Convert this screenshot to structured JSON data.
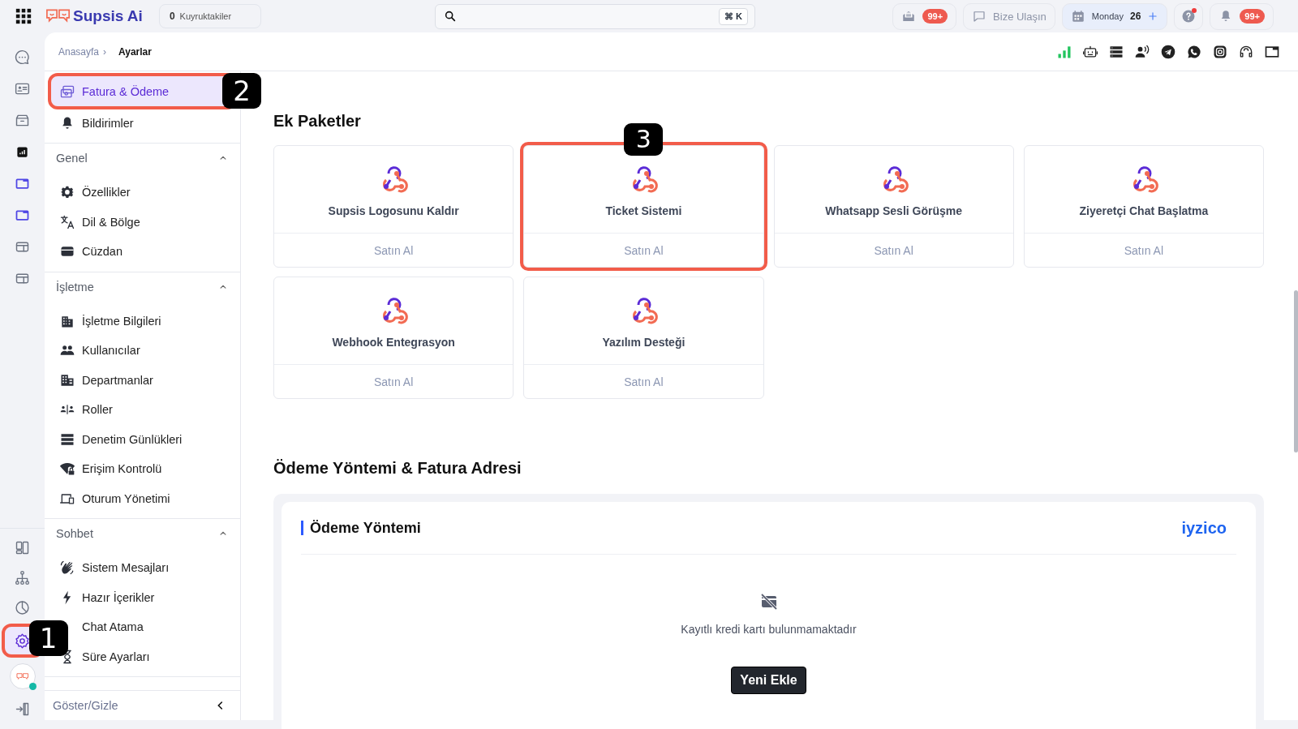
{
  "top_bar": {
    "logo": "Supsis Ai",
    "queue_count": "0",
    "queue_label": "Kuyruktakiler",
    "search_shortcut": "⌘ K",
    "inbox_badge": "99+",
    "contact_label": "Bize Ulaşın",
    "date_day": "Monday",
    "date_num": "26",
    "help_alert": true,
    "notifications_badge": "99+"
  },
  "rail": {
    "items": [
      {
        "selected": false
      },
      {
        "selected": false
      },
      {
        "selected": false
      },
      {
        "selected": false
      },
      {
        "selected": false
      },
      {
        "selected": false
      },
      {
        "selected": false
      },
      {
        "selected": false
      }
    ],
    "bottom_items": [
      {
        "selected": false
      },
      {
        "selected": false
      },
      {
        "selected": false
      },
      {
        "selected": true,
        "callout": "1"
      }
    ],
    "avatar_online": true
  },
  "breadcrumb": {
    "items": [
      "Anasayfa",
      "Ayarlar"
    ],
    "separator": "›"
  },
  "sidebar": {
    "items": [
      {
        "label": "Fatura & Ödeme",
        "selected": true,
        "callout": "2"
      },
      {
        "label": "Bildirimler",
        "selected": false
      }
    ],
    "sections": [
      {
        "title": "Genel",
        "expanded": true,
        "items": [
          {
            "label": "Özellikler",
            "selected": false
          },
          {
            "label": "Dil & Bölge",
            "selected": false
          },
          {
            "label": "Cüzdan",
            "selected": false
          }
        ]
      },
      {
        "title": "İşletme",
        "expanded": true,
        "items": [
          {
            "label": "İşletme Bilgileri",
            "selected": false
          },
          {
            "label": "Kullanıcılar",
            "selected": false
          },
          {
            "label": "Departmanlar",
            "selected": false
          },
          {
            "label": "Roller",
            "selected": false
          },
          {
            "label": "Denetim Günlükleri",
            "selected": false
          },
          {
            "label": "Erişim Kontrolü",
            "selected": false
          },
          {
            "label": "Oturum Yönetimi",
            "selected": false
          }
        ]
      },
      {
        "title": "Sohbet",
        "expanded": true,
        "items": [
          {
            "label": "Sistem Mesajları",
            "selected": false
          },
          {
            "label": "Hazır İçerikler",
            "selected": false
          },
          {
            "label": "Chat Atama",
            "selected": false
          },
          {
            "label": "Süre Ayarları",
            "selected": false
          }
        ]
      }
    ],
    "footer": "Göster/Gizle"
  },
  "packages": {
    "title": "Ek Paketler",
    "items": [
      {
        "name": "Supsis Logosunu Kaldır",
        "action": "Satın Al"
      },
      {
        "name": "Ticket Sistemi",
        "action": "Satın Al",
        "callout": "3"
      },
      {
        "name": "Whatsapp Sesli Görüşme",
        "action": "Satın Al"
      },
      {
        "name": "Ziyeretçi Chat Başlatma",
        "action": "Satın Al"
      },
      {
        "name": "Webhook Entegrasyon",
        "action": "Satın Al"
      },
      {
        "name": "Yazılım Desteği",
        "action": "Satın Al"
      }
    ]
  },
  "payment": {
    "title": "Ödeme Yöntemi & Fatura Adresi",
    "card_title": "Ödeme Yöntemi",
    "provider": "iyzico",
    "empty_message": "Kayıtlı kredi kartı bulunmamaktadır",
    "add_button": "Yeni Ekle"
  }
}
